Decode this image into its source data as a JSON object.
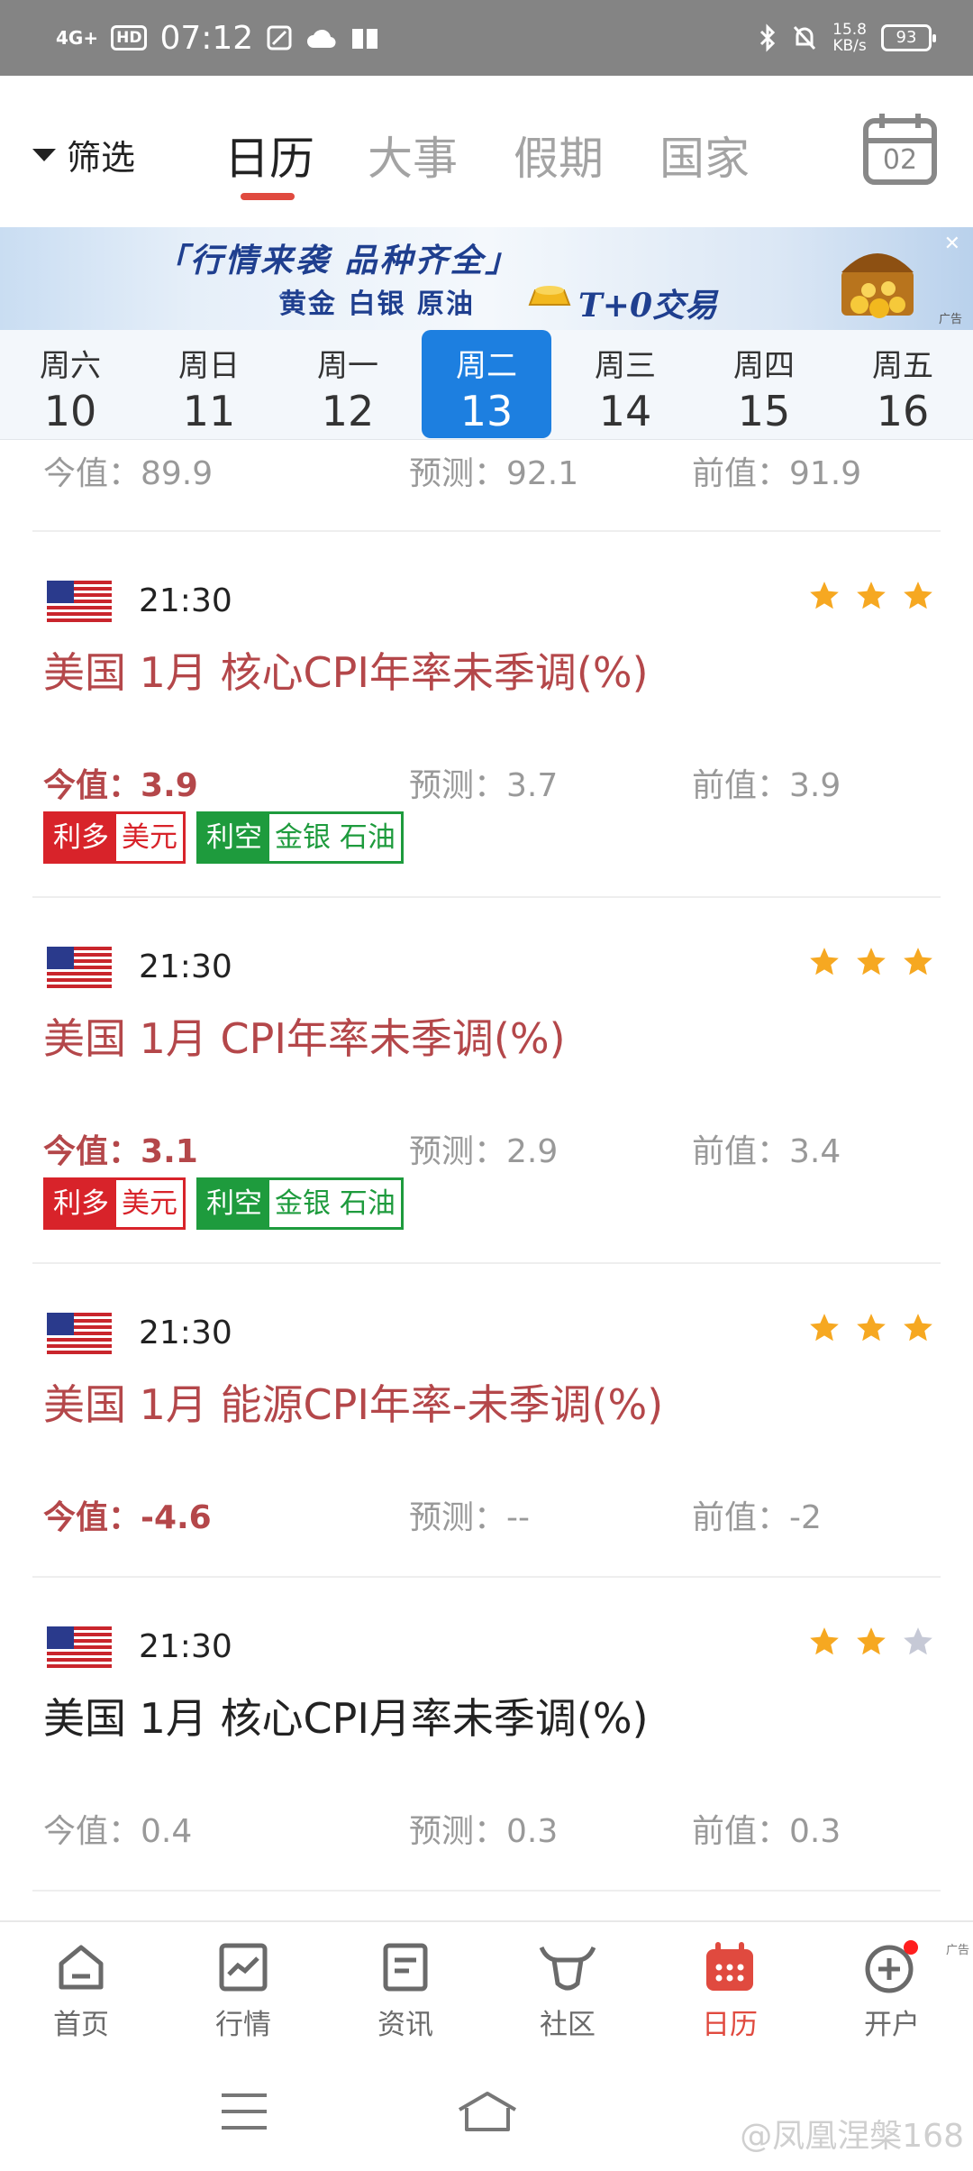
{
  "status_bar": {
    "network": "4G+",
    "hd": "HD",
    "time": "07:12",
    "speed_value": "15.8",
    "speed_unit": "KB/s",
    "battery": "93"
  },
  "header": {
    "filter_label": "筛选",
    "tabs": [
      {
        "label": "日历",
        "active": true
      },
      {
        "label": "大事",
        "active": false
      },
      {
        "label": "假期",
        "active": false
      },
      {
        "label": "国家",
        "active": false
      }
    ],
    "calendar_day": "02"
  },
  "ad": {
    "line1": "「行情来袭 品种齐全」",
    "line2": "黄金 白银 原油",
    "line3": "T+0交易",
    "arrows": "«",
    "close": "✕",
    "tag": "广告"
  },
  "date_strip": [
    {
      "weekday": "周六",
      "day": "10",
      "active": false
    },
    {
      "weekday": "周日",
      "day": "11",
      "active": false
    },
    {
      "weekday": "周一",
      "day": "12",
      "active": false
    },
    {
      "weekday": "周二",
      "day": "13",
      "active": true
    },
    {
      "weekday": "周三",
      "day": "14",
      "active": false
    },
    {
      "weekday": "周四",
      "day": "15",
      "active": false
    },
    {
      "weekday": "周五",
      "day": "16",
      "active": false
    }
  ],
  "partial_row": {
    "actual": "今值：89.9",
    "forecast": "预测：92.1",
    "previous": "前值：91.9"
  },
  "events": [
    {
      "time": "21:30",
      "stars": 3,
      "title": "美国 1月 核心CPI年率未季调(%)",
      "actual_label": "今值：",
      "actual_value": "3.9",
      "forecast": "预测：3.7",
      "previous": "前值：3.9",
      "bull_key": "利多",
      "bull_val": "美元",
      "bear_key": "利空",
      "bear_val": "金银 石油"
    },
    {
      "time": "21:30",
      "stars": 3,
      "title": "美国 1月 CPI年率未季调(%)",
      "actual_label": "今值：",
      "actual_value": "3.1",
      "forecast": "预测：2.9",
      "previous": "前值：3.4",
      "bull_key": "利多",
      "bull_val": "美元",
      "bear_key": "利空",
      "bear_val": "金银 石油"
    },
    {
      "time": "21:30",
      "stars": 3,
      "title": "美国 1月 能源CPI年率-未季调(%)",
      "actual_label": "今值：",
      "actual_value": "-4.6",
      "forecast": "预测：--",
      "previous": "前值：-2"
    },
    {
      "time": "21:30",
      "stars": 2,
      "title": "美国 1月 核心CPI月率未季调(%)",
      "actual_label": "今值：",
      "actual_value": "0.4",
      "forecast": "预测：0.3",
      "previous": "前值：0.3"
    }
  ],
  "bottom_nav": [
    {
      "label": "首页",
      "icon": "home-icon",
      "active": false
    },
    {
      "label": "行情",
      "icon": "market-chart-icon",
      "active": false
    },
    {
      "label": "资讯",
      "icon": "news-icon",
      "active": false
    },
    {
      "label": "社区",
      "icon": "bull-icon",
      "active": false
    },
    {
      "label": "日历",
      "icon": "calendar-icon",
      "active": true
    },
    {
      "label": "开户",
      "icon": "add-account-icon",
      "active": false
    }
  ],
  "nav_ad_tag": "广告",
  "watermark": "@凤凰涅槃168",
  "colors": {
    "accent_red": "#e04a3f",
    "title_red": "#b4474a",
    "active_date_blue": "#1d7fe0",
    "bull_red": "#d8232a",
    "bear_green": "#1e9b3d",
    "star_gold": "#f6a821",
    "star_grey": "#c6c9d6"
  }
}
